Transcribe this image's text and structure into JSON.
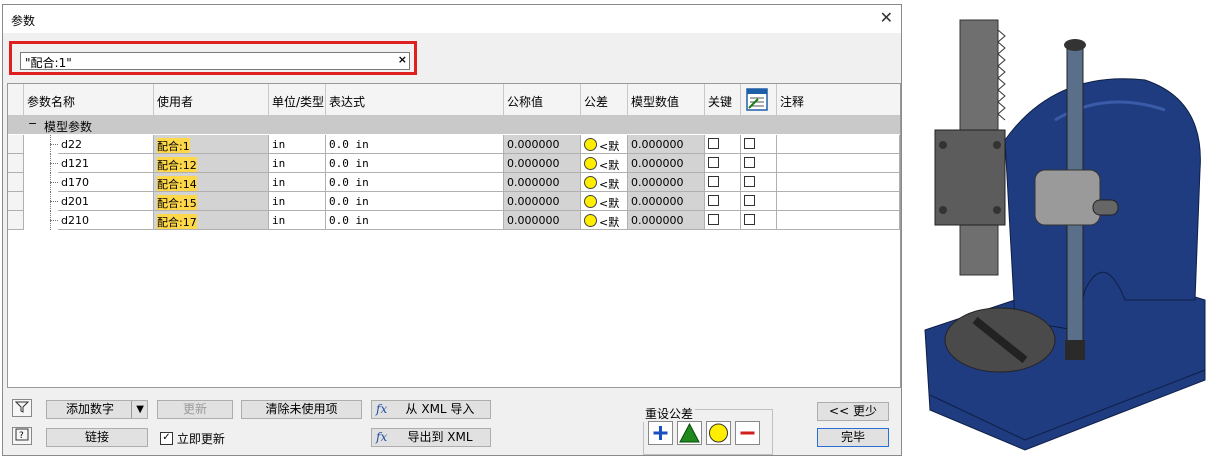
{
  "dialog": {
    "title": "参数",
    "filter_value": "\"配合:1\"",
    "filter_clear": "×"
  },
  "columns": [
    "参数名称",
    "使用者",
    "单位/类型",
    "表达式",
    "公称值",
    "公差",
    "模型数值",
    "关键",
    "",
    "注释"
  ],
  "group_label": "模型参数",
  "group_toggle": "−",
  "rows": [
    {
      "name": "d22",
      "used_by": "配合:1",
      "unit": "in",
      "expr": "0.0 in",
      "nominal": "0.000000",
      "tol": "<默",
      "model": "0.000000"
    },
    {
      "name": "d121",
      "used_by": "配合:12",
      "unit": "in",
      "expr": "0.0 in",
      "nominal": "0.000000",
      "tol": "<默",
      "model": "0.000000"
    },
    {
      "name": "d170",
      "used_by": "配合:14",
      "unit": "in",
      "expr": "0.0 in",
      "nominal": "0.000000",
      "tol": "<默",
      "model": "0.000000"
    },
    {
      "name": "d201",
      "used_by": "配合:15",
      "unit": "in",
      "expr": "0.0 in",
      "nominal": "0.000000",
      "tol": "<默",
      "model": "0.000000"
    },
    {
      "name": "d210",
      "used_by": "配合:17",
      "unit": "in",
      "expr": "0.0 in",
      "nominal": "0.000000",
      "tol": "<默",
      "model": "0.000000"
    }
  ],
  "buttons": {
    "add_number": "添加数字",
    "update": "更新",
    "purge": "清除未使用项",
    "import_xml": "从 XML 导入",
    "link": "链接",
    "immediate_update": "立即更新",
    "export_xml": "导出到 XML",
    "less": "<< 更少",
    "done": "完毕"
  },
  "reset_tolerance": {
    "title": "重设公差"
  },
  "colors": {
    "highlight": "#ffd84a",
    "red_border": "#e02020",
    "press_blue": "#1f3c80"
  }
}
